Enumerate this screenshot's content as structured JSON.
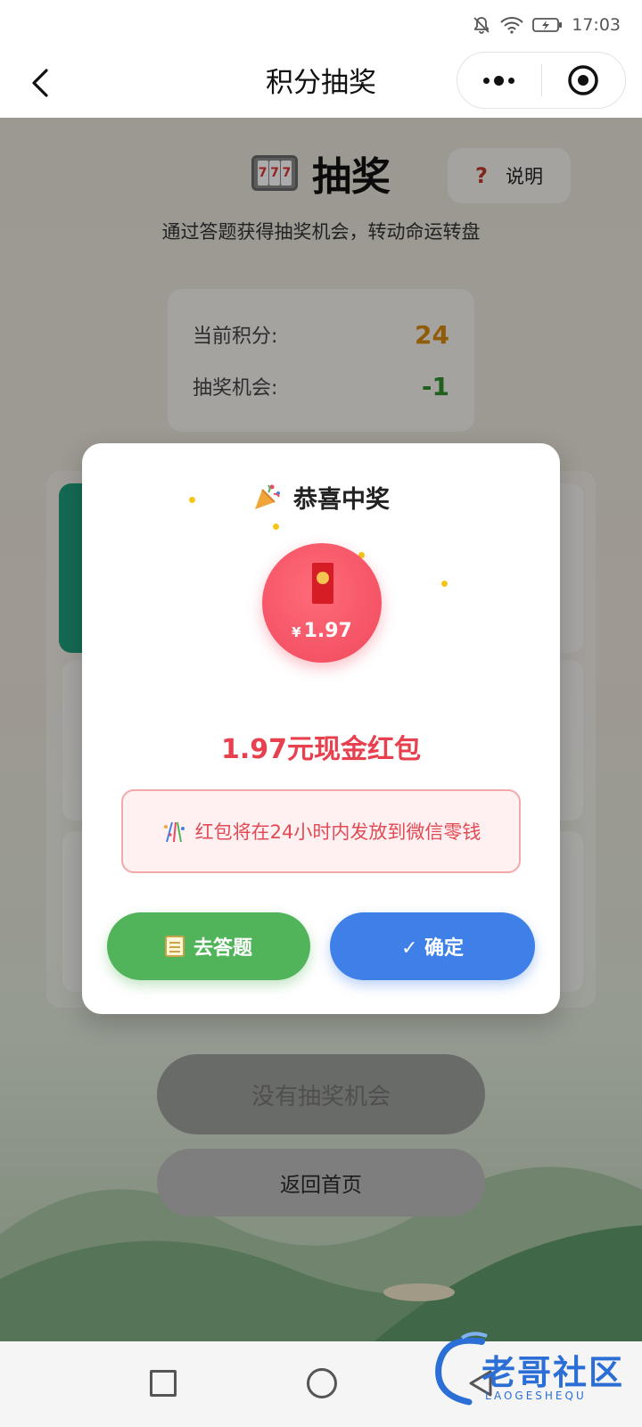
{
  "status_bar": {
    "time": "17:03"
  },
  "title_bar": {
    "title": "积分抽奖"
  },
  "page": {
    "lottery_title": "抽奖",
    "slot_digits": [
      "7",
      "7",
      "7"
    ],
    "help_label": "说明",
    "help_mark": "?",
    "subtitle": "通过答题获得抽奖机会，转动命运转盘",
    "stats": {
      "points_label": "当前积分:",
      "points_value": "24",
      "chances_label": "抽奖机会:",
      "chances_value": "-1"
    },
    "no_chance_button": "没有抽奖机会",
    "home_button": "返回首页"
  },
  "modal": {
    "title": "恭喜中奖",
    "prize_currency": "¥",
    "prize_amount": "1.97",
    "prize_text": "1.97元现金红包",
    "notice": "红包将在24小时内发放到微信零钱",
    "quiz_button": "去答题",
    "confirm_button": "✓ 确定"
  },
  "watermark": {
    "text": "老哥社区",
    "sub": "LAOGESHEQU"
  },
  "colors": {
    "accent_red": "#e8404f",
    "quiz_green": "#52b45a",
    "confirm_blue": "#3f80e8",
    "points_orange": "#d98a10",
    "chances_green": "#2f8f2f"
  }
}
